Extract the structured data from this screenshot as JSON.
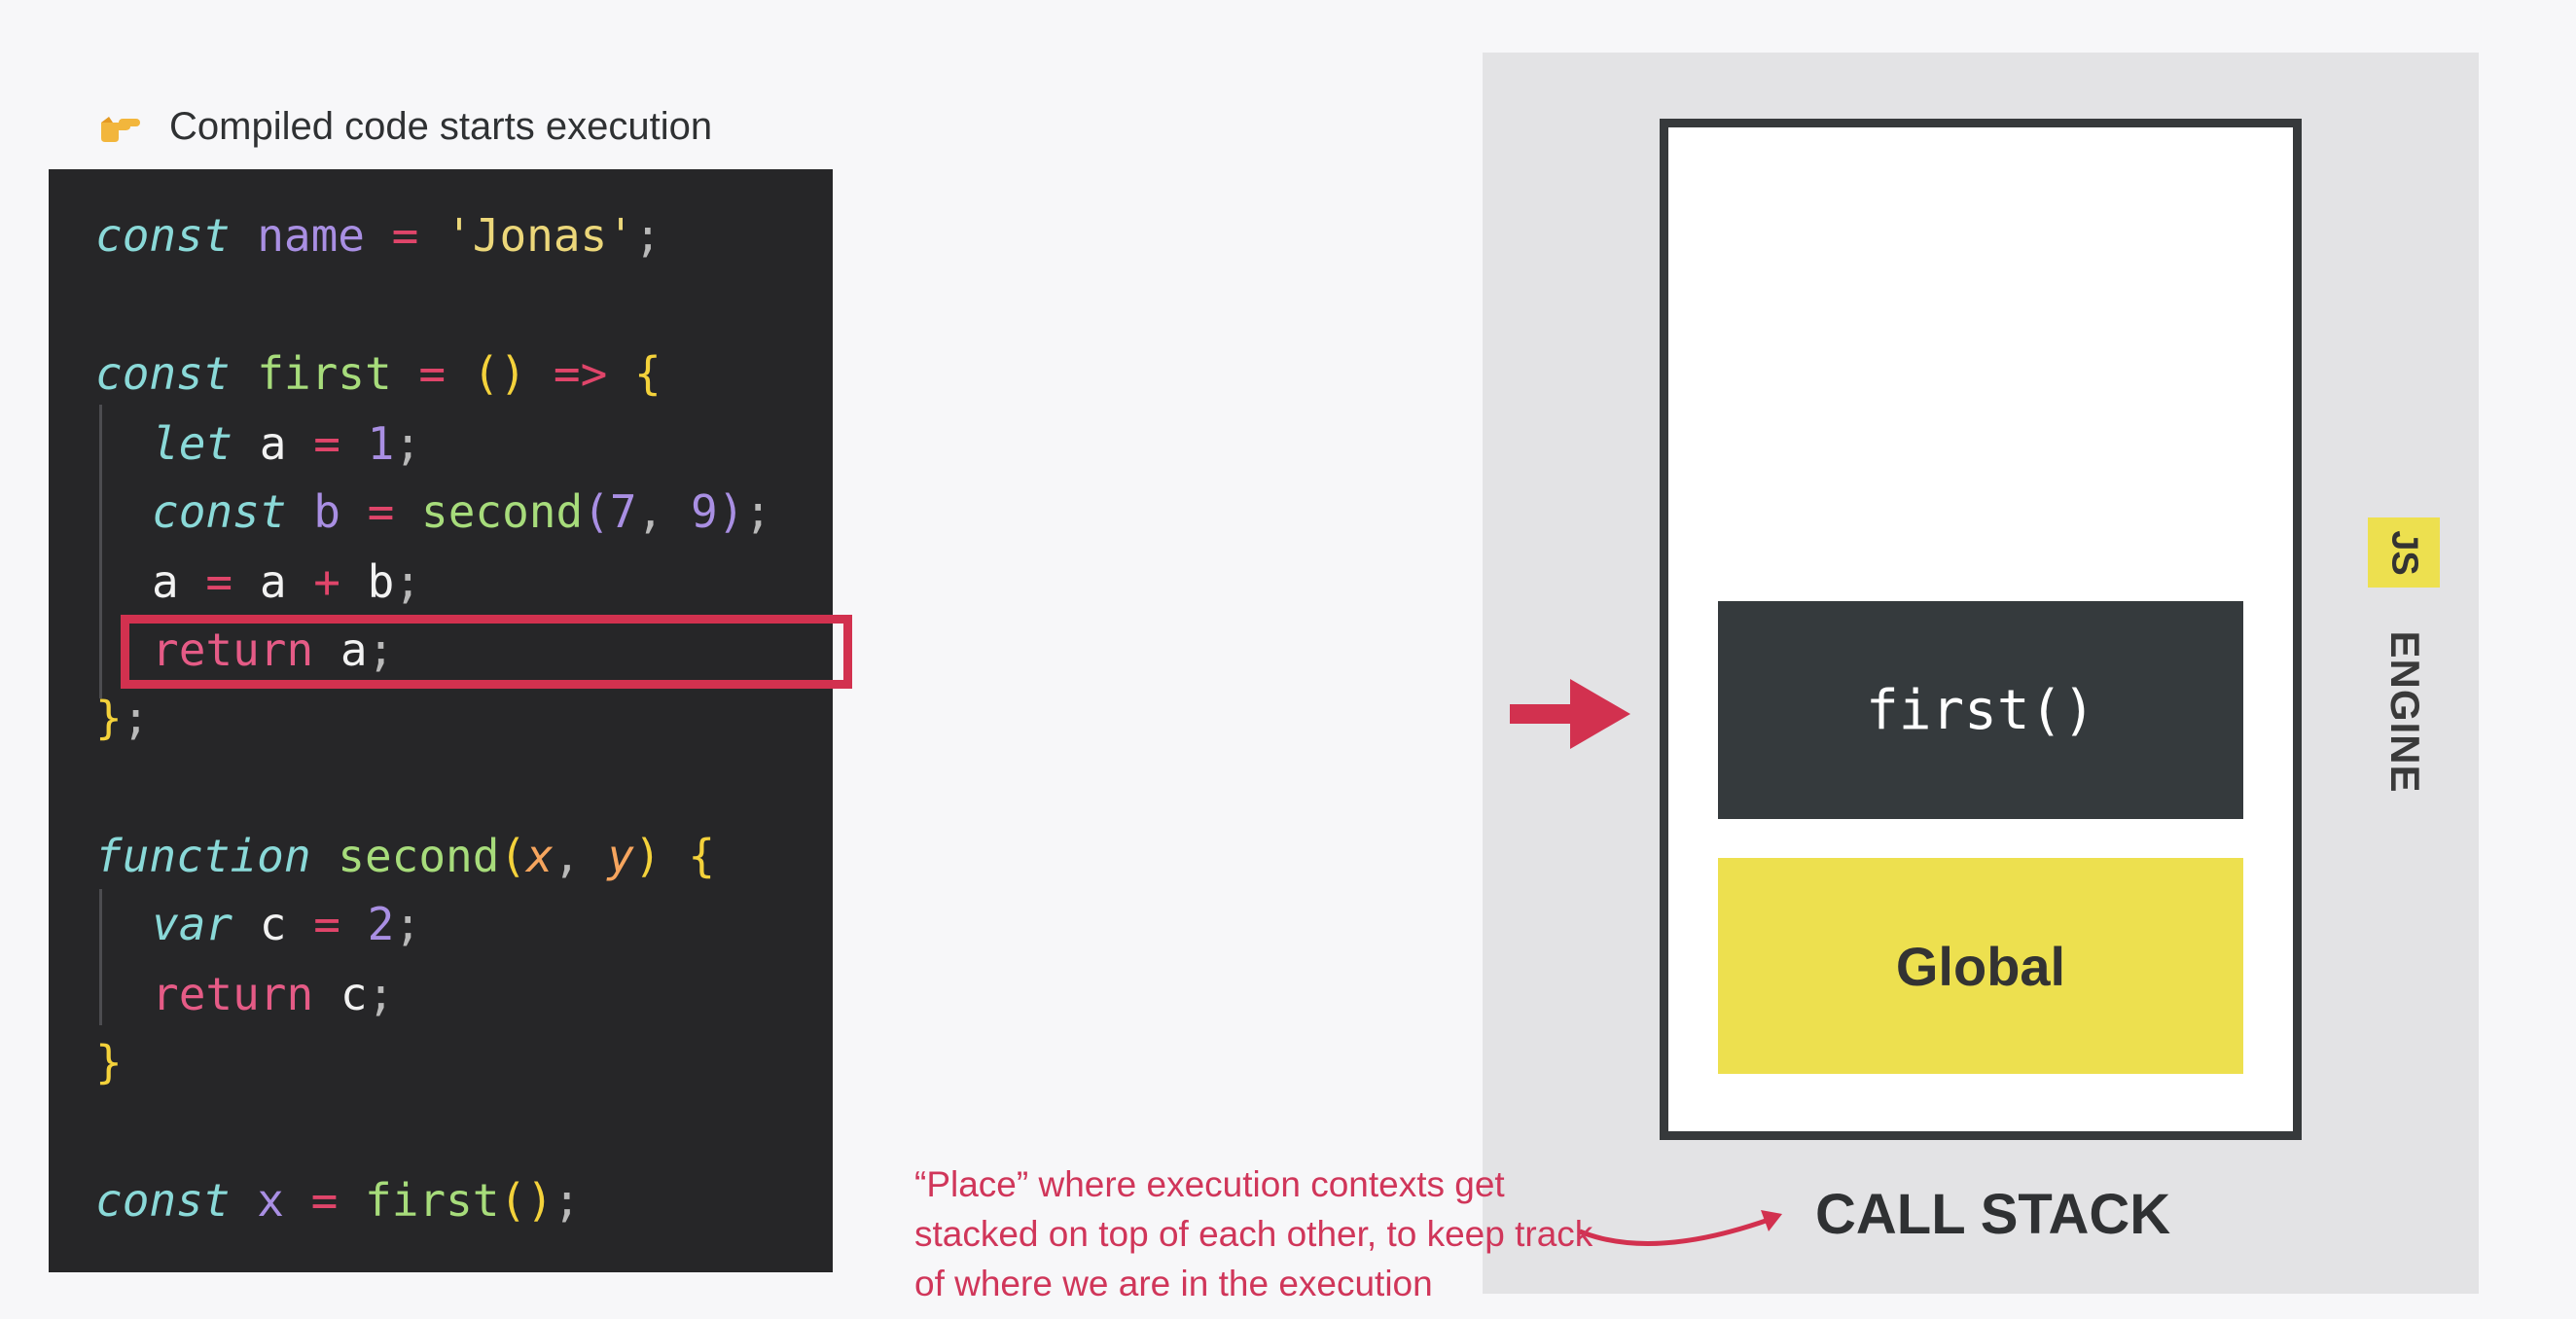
{
  "header": {
    "text": "Compiled code starts execution",
    "icon": "pointing-hand-icon"
  },
  "code": {
    "l1": {
      "kw": "const",
      "v": "name",
      "op": "=",
      "s": "'Jonas'",
      "end": ";"
    },
    "l2": {
      "kw": "const",
      "fn": "first",
      "op": "=",
      "parens": "()",
      "arrow": "=>",
      "brace": "{"
    },
    "l3": {
      "kw": "let",
      "v": "a",
      "op": "=",
      "num": "1",
      "end": ";"
    },
    "l4": {
      "kw": "const",
      "v": "b",
      "op": "=",
      "fn": "second",
      "open": "(",
      "n1": "7",
      "comma": ",",
      "n2": "9",
      "close": ")",
      "end": ";"
    },
    "l5": {
      "a1": "a",
      "op1": "=",
      "a2": "a",
      "op2": "+",
      "b": "b",
      "end": ";"
    },
    "l6": {
      "ret": "return",
      "v": "a",
      "end": ";"
    },
    "l7": {
      "brace": "}",
      "end": ";"
    },
    "l8": {
      "kw": "function",
      "fn": "second",
      "open": "(",
      "p1": "x",
      "comma": ",",
      "p2": "y",
      "close": ")",
      "brace": "{"
    },
    "l9": {
      "kw": "var",
      "v": "c",
      "op": "=",
      "num": "2",
      "end": ";"
    },
    "l10": {
      "ret": "return",
      "v": "c",
      "end": ";"
    },
    "l11": {
      "brace": "}"
    },
    "l12": {
      "kw": "const",
      "v": "x",
      "op": "=",
      "fn": "first",
      "parens": "()",
      "end": ";"
    }
  },
  "call_stack": {
    "title": "CALL STACK",
    "contexts": [
      "first()",
      "Global"
    ]
  },
  "engine": {
    "badge": "JS",
    "label": "ENGINE"
  },
  "note": "“Place” where execution contexts get stacked on top of each other, to keep track of where we are in the execution",
  "colors": {
    "accent": "#d2314f",
    "global": "#ede04f",
    "context": "#353a3d",
    "code_bg": "#262628"
  }
}
